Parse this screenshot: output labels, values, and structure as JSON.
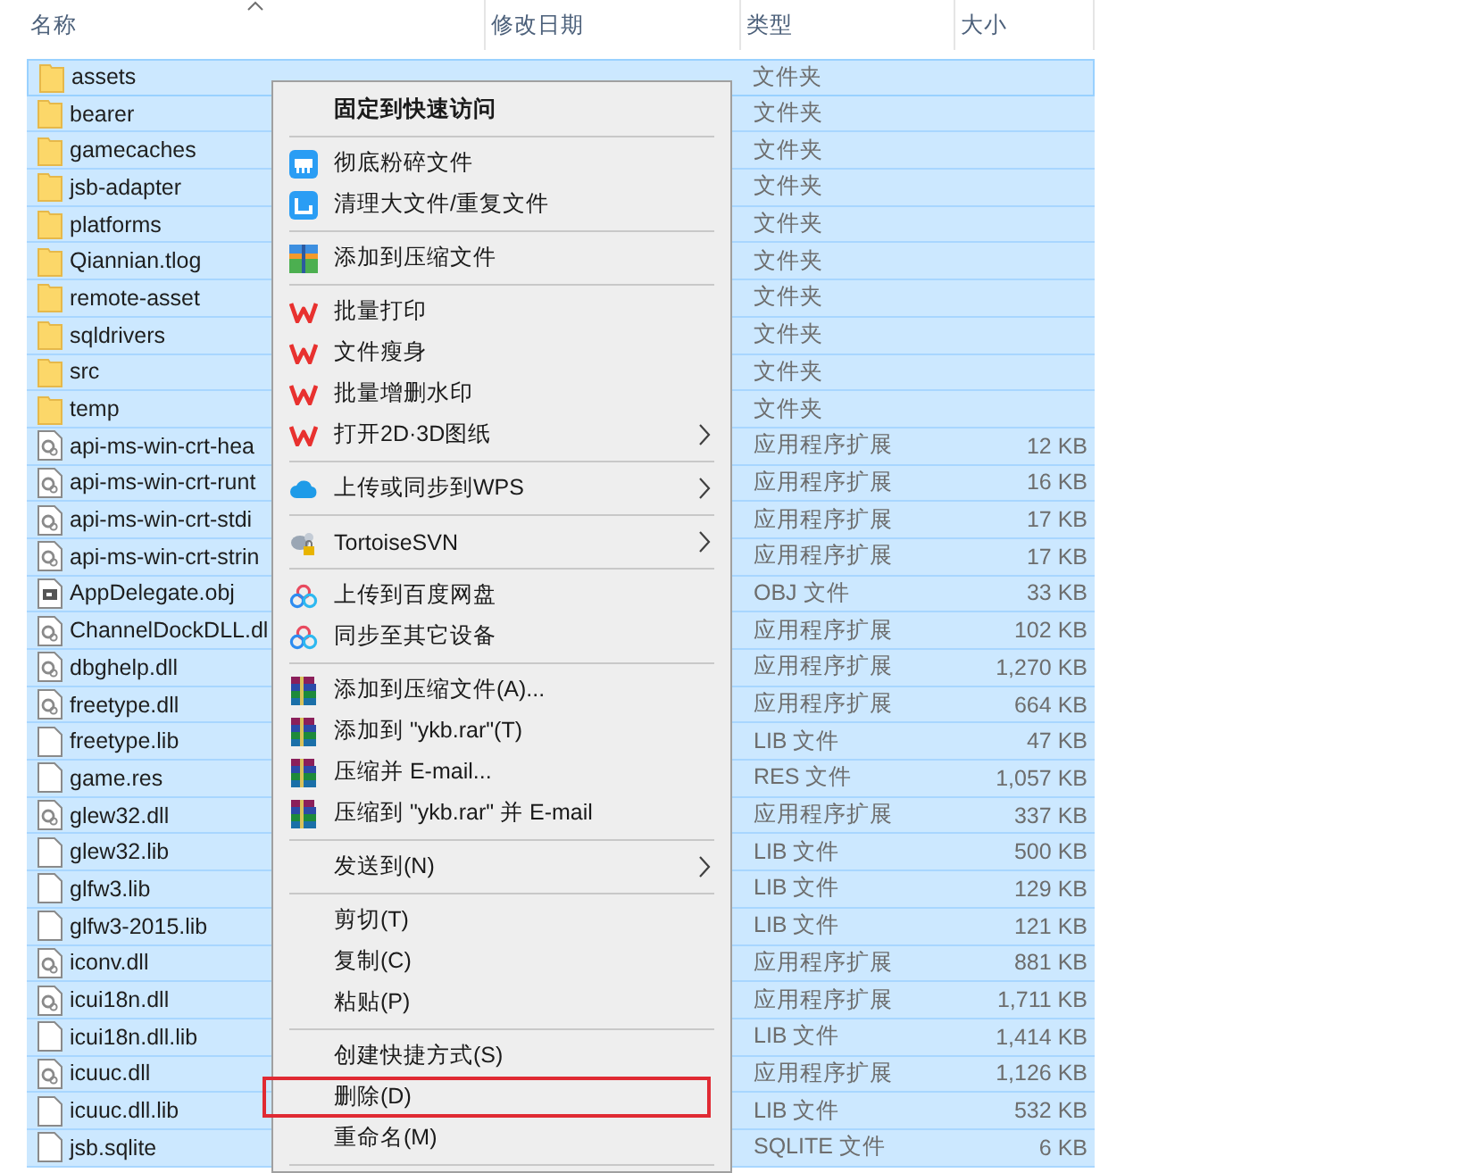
{
  "columns": [
    {
      "label": "名称",
      "sorted": true
    },
    {
      "label": "修改日期",
      "sorted": false
    },
    {
      "label": "类型",
      "sorted": false
    },
    {
      "label": "大小",
      "sorted": false
    }
  ],
  "rows": [
    {
      "kind": "folder",
      "name": "assets",
      "type": "文件夹",
      "selected": true,
      "focused": true
    },
    {
      "kind": "folder",
      "name": "bearer",
      "type": "文件夹",
      "selected": true,
      "focused": false
    },
    {
      "kind": "folder",
      "name": "gamecaches",
      "type": "文件夹",
      "selected": true,
      "focused": false
    },
    {
      "kind": "folder",
      "name": "jsb-adapter",
      "type": "文件夹",
      "selected": true,
      "focused": false
    },
    {
      "kind": "folder",
      "name": "platforms",
      "type": "文件夹",
      "selected": true,
      "focused": false
    },
    {
      "kind": "folder",
      "name": "Qiannian.tlog",
      "type": "文件夹",
      "selected": true,
      "focused": false
    },
    {
      "kind": "folder",
      "name": "remote-asset",
      "type": "文件夹",
      "selected": true,
      "focused": false
    },
    {
      "kind": "folder",
      "name": "sqldrivers",
      "type": "文件夹",
      "selected": true,
      "focused": false
    },
    {
      "kind": "folder",
      "name": "src",
      "type": "文件夹",
      "selected": true,
      "focused": false
    },
    {
      "kind": "folder",
      "name": "temp",
      "type": "文件夹",
      "selected": true,
      "focused": false
    },
    {
      "kind": "dll",
      "name": "api-ms-win-crt-hea",
      "type": "应用程序扩展",
      "size": "12 KB",
      "selected": true,
      "focused": false
    },
    {
      "kind": "dll",
      "name": "api-ms-win-crt-runt",
      "type": "应用程序扩展",
      "size": "16 KB",
      "selected": true,
      "focused": false
    },
    {
      "kind": "dll",
      "name": "api-ms-win-crt-stdi",
      "type": "应用程序扩展",
      "size": "17 KB",
      "selected": true,
      "focused": false
    },
    {
      "kind": "dll",
      "name": "api-ms-win-crt-strin",
      "type": "应用程序扩展",
      "size": "17 KB",
      "selected": true,
      "focused": false
    },
    {
      "kind": "obj",
      "name": "AppDelegate.obj",
      "type": "OBJ 文件",
      "size": "33 KB",
      "selected": true,
      "focused": false
    },
    {
      "kind": "dll",
      "name": "ChannelDockDLL.dl",
      "type": "应用程序扩展",
      "size": "102 KB",
      "selected": true,
      "focused": false
    },
    {
      "kind": "dll",
      "name": "dbghelp.dll",
      "type": "应用程序扩展",
      "size": "1,270 KB",
      "selected": true,
      "focused": false
    },
    {
      "kind": "dll",
      "name": "freetype.dll",
      "type": "应用程序扩展",
      "size": "664 KB",
      "selected": true,
      "focused": false
    },
    {
      "kind": "file",
      "name": "freetype.lib",
      "type": "LIB 文件",
      "size": "47 KB",
      "selected": true,
      "focused": false
    },
    {
      "kind": "file",
      "name": "game.res",
      "type": "RES 文件",
      "size": "1,057 KB",
      "selected": true,
      "focused": false
    },
    {
      "kind": "dll",
      "name": "glew32.dll",
      "type": "应用程序扩展",
      "size": "337 KB",
      "selected": true,
      "focused": false
    },
    {
      "kind": "file",
      "name": "glew32.lib",
      "type": "LIB 文件",
      "size": "500 KB",
      "selected": true,
      "focused": false
    },
    {
      "kind": "file",
      "name": "glfw3.lib",
      "type": "LIB 文件",
      "size": "129 KB",
      "selected": true,
      "focused": false
    },
    {
      "kind": "file",
      "name": "glfw3-2015.lib",
      "type": "LIB 文件",
      "size": "121 KB",
      "selected": true,
      "focused": false
    },
    {
      "kind": "dll",
      "name": "iconv.dll",
      "type": "应用程序扩展",
      "size": "881 KB",
      "selected": true,
      "focused": false
    },
    {
      "kind": "dll",
      "name": "icui18n.dll",
      "type": "应用程序扩展",
      "size": "1,711 KB",
      "selected": true,
      "focused": false
    },
    {
      "kind": "file",
      "name": "icui18n.dll.lib",
      "type": "LIB 文件",
      "size": "1,414 KB",
      "selected": true,
      "focused": false
    },
    {
      "kind": "dll",
      "name": "icuuc.dll",
      "type": "应用程序扩展",
      "size": "1,126 KB",
      "selected": true,
      "focused": false
    },
    {
      "kind": "file",
      "name": "icuuc.dll.lib",
      "type": "LIB 文件",
      "size": "532 KB",
      "selected": true,
      "focused": false
    },
    {
      "kind": "file",
      "name": "jsb.sqlite",
      "type": "SQLITE 文件",
      "size": "6 KB",
      "selected": true,
      "focused": false
    }
  ],
  "context_menu": [
    {
      "kind": "plain",
      "label": "固定到快速访问",
      "default": true,
      "submenu": false
    },
    {
      "kind": "separator"
    },
    {
      "kind": "shredder",
      "label": "彻底粉碎文件",
      "default": false,
      "submenu": false
    },
    {
      "kind": "cleaner",
      "label": "清理大文件/重复文件",
      "default": false,
      "submenu": false
    },
    {
      "kind": "separator"
    },
    {
      "kind": "archive",
      "label": "添加到压缩文件",
      "default": false,
      "submenu": false
    },
    {
      "kind": "separator"
    },
    {
      "kind": "wps",
      "label": "批量打印",
      "default": false,
      "submenu": false
    },
    {
      "kind": "wps",
      "label": "文件瘦身",
      "default": false,
      "submenu": false
    },
    {
      "kind": "wps",
      "label": "批量增删水印",
      "default": false,
      "submenu": false
    },
    {
      "kind": "wps",
      "label": "打开2D·3D图纸",
      "default": false,
      "submenu": true
    },
    {
      "kind": "separator"
    },
    {
      "kind": "cloud",
      "label": "上传或同步到WPS",
      "default": false,
      "submenu": true
    },
    {
      "kind": "separator"
    },
    {
      "kind": "svn",
      "label": "TortoiseSVN",
      "default": false,
      "submenu": true
    },
    {
      "kind": "separator"
    },
    {
      "kind": "baidu",
      "label": "上传到百度网盘",
      "default": false,
      "submenu": false
    },
    {
      "kind": "baidu",
      "label": "同步至其它设备",
      "default": false,
      "submenu": false
    },
    {
      "kind": "separator"
    },
    {
      "kind": "rar",
      "label": "添加到压缩文件(A)...",
      "default": false,
      "submenu": false
    },
    {
      "kind": "rar",
      "label": "添加到 \"ykb.rar\"(T)",
      "default": false,
      "submenu": false
    },
    {
      "kind": "rar",
      "label": "压缩并 E-mail...",
      "default": false,
      "submenu": false
    },
    {
      "kind": "rar",
      "label": "压缩到 \"ykb.rar\" 并 E-mail",
      "default": false,
      "submenu": false
    },
    {
      "kind": "separator"
    },
    {
      "kind": "plain",
      "label": "发送到(N)",
      "default": false,
      "submenu": true
    },
    {
      "kind": "separator"
    },
    {
      "kind": "plain",
      "label": "剪切(T)",
      "default": false,
      "submenu": false
    },
    {
      "kind": "plain",
      "label": "复制(C)",
      "default": false,
      "submenu": false
    },
    {
      "kind": "plain",
      "label": "粘贴(P)",
      "default": false,
      "submenu": false
    },
    {
      "kind": "separator"
    },
    {
      "kind": "plain",
      "label": "创建快捷方式(S)",
      "default": false,
      "submenu": false
    },
    {
      "kind": "plain",
      "label": "删除(D)",
      "default": false,
      "submenu": false,
      "highlighted": true
    },
    {
      "kind": "plain",
      "label": "重命名(M)",
      "default": false,
      "submenu": false
    },
    {
      "kind": "separator"
    }
  ]
}
